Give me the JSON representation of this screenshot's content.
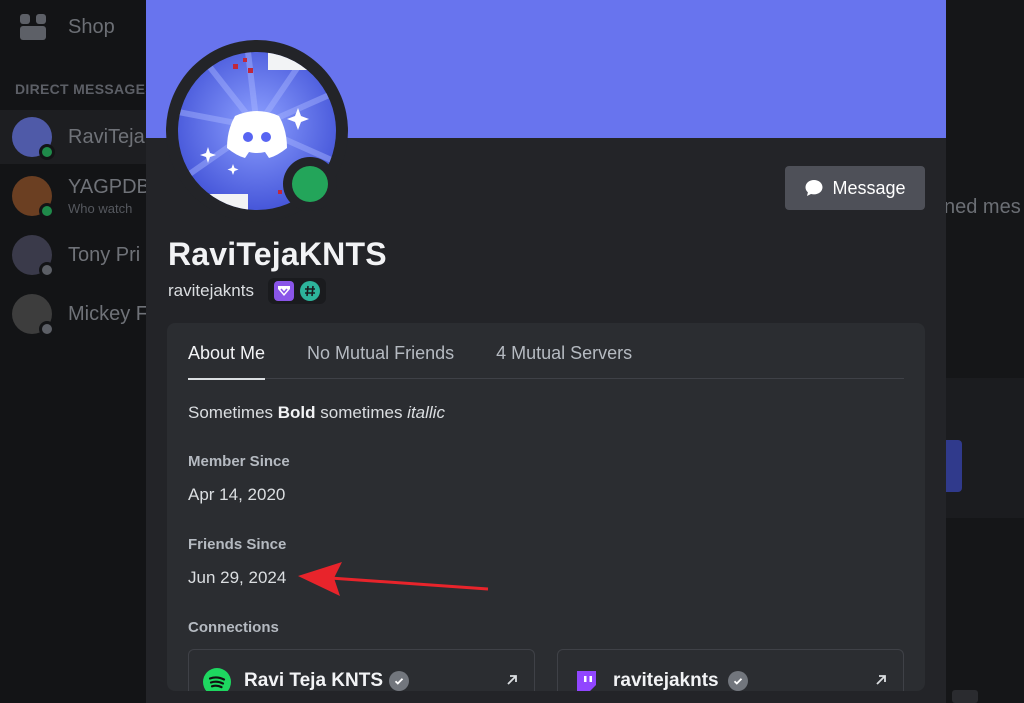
{
  "background": {
    "shop_label": "Shop",
    "dm_header": "DIRECT MESSAGES",
    "dms": [
      {
        "name": "RaviTeja",
        "sub": ""
      },
      {
        "name": "YAGPDB",
        "sub": "Who watch"
      },
      {
        "name": "Tony Pri",
        "sub": ""
      },
      {
        "name": "Mickey F",
        "sub": ""
      }
    ],
    "right_text": "ned mes"
  },
  "profile": {
    "display_name": "RaviTejaKNTS",
    "username": "ravitejaknts",
    "message_button": "Message",
    "status_color": "#23a55a",
    "banner_color": "#6874ee"
  },
  "tabs": [
    {
      "label": "About Me",
      "active": true
    },
    {
      "label": "No Mutual Friends",
      "active": false
    },
    {
      "label": "4 Mutual Servers",
      "active": false
    }
  ],
  "about": {
    "bio_pre": "Sometimes ",
    "bio_bold": "Bold",
    "bio_mid": " sometimes ",
    "bio_italic": "itallic",
    "member_since_label": "Member Since",
    "member_since_value": "Apr 14, 2020",
    "friends_since_label": "Friends Since",
    "friends_since_value": "Jun 29, 2024",
    "connections_label": "Connections"
  },
  "connections": [
    {
      "service": "spotify-icon",
      "name": "Ravi Teja KNTS",
      "color": "#1ed760"
    },
    {
      "service": "twitch-icon",
      "name": "ravitejaknts",
      "color": "#9146ff"
    }
  ],
  "annotation_color": "#e8242b"
}
